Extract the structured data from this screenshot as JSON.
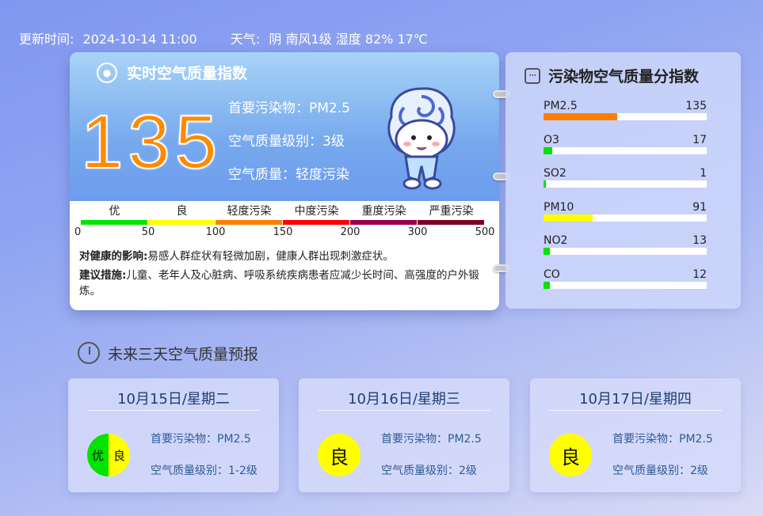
{
  "topbar": {
    "update_label": "更新时间:",
    "update_time": "2024-10-14 11:00",
    "weather_label": "天气:",
    "weather_value": "阴 南风1级 湿度 82% 17℃"
  },
  "aqi": {
    "title": "实时空气质量指数",
    "value": "135",
    "primary_pollutant": "首要污染物：PM2.5",
    "level": "空气质量级别：3级",
    "quality": "空气质量：轻度污染"
  },
  "scale": {
    "categories": [
      {
        "label": "优",
        "color": "#00e400"
      },
      {
        "label": "良",
        "color": "#ffff00"
      },
      {
        "label": "轻度污染",
        "color": "#ff7e00"
      },
      {
        "label": "中度污染",
        "color": "#ff0000"
      },
      {
        "label": "重度污染",
        "color": "#99004c"
      },
      {
        "label": "严重污染",
        "color": "#7e0023"
      }
    ],
    "ticks": [
      "0",
      "50",
      "100",
      "150",
      "200",
      "300",
      "500"
    ]
  },
  "health": {
    "impact_label": "对健康的影响:",
    "impact_text": "易感人群症状有轻微加剧，健康人群出现刺激症状。",
    "advice_label": "建议措施:",
    "advice_text": "儿童、老年人及心脏病、呼吸系统疾病患者应减少长时间、高强度的户外锻炼。"
  },
  "pollutants": {
    "title": "污染物空气质量分指数",
    "items": [
      {
        "name": "PM2.5",
        "value": "135",
        "fraction": 0.45,
        "color": "#ff7e00"
      },
      {
        "name": "O3",
        "value": "17",
        "fraction": 0.055,
        "color": "#00e400"
      },
      {
        "name": "SO2",
        "value": "1",
        "fraction": 0.006,
        "color": "#00e400"
      },
      {
        "name": "PM10",
        "value": "91",
        "fraction": 0.3,
        "color": "#ffff00"
      },
      {
        "name": "NO2",
        "value": "13",
        "fraction": 0.04,
        "color": "#00e400"
      },
      {
        "name": "CO",
        "value": "12",
        "fraction": 0.04,
        "color": "#00e400"
      }
    ]
  },
  "forecast": {
    "title": "未来三天空气质量预报",
    "days": [
      {
        "date": "10月15日/星期二",
        "badge": [
          "优",
          "良"
        ],
        "badge_colors": [
          "#00e400",
          "#ffff00"
        ],
        "primary": "首要污染物：PM2.5",
        "level": "空气质量级别：1-2级"
      },
      {
        "date": "10月16日/星期三",
        "badge": [
          "良"
        ],
        "badge_colors": [
          "#ffff00"
        ],
        "primary": "首要污染物：PM2.5",
        "level": "空气质量级别：2级"
      },
      {
        "date": "10月17日/星期四",
        "badge": [
          "良"
        ],
        "badge_colors": [
          "#ffff00"
        ],
        "primary": "首要污染物：PM2.5",
        "level": "空气质量级别：2级"
      }
    ]
  }
}
